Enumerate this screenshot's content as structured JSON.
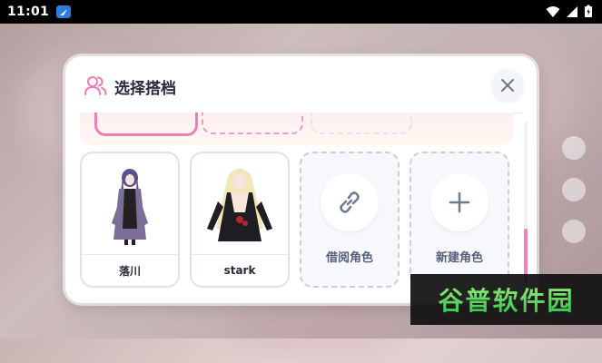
{
  "status_bar": {
    "time": "11:01"
  },
  "dialog": {
    "title": "选择搭档",
    "icons": {
      "header": "users-icon",
      "close": "close-icon"
    }
  },
  "characters": [
    {
      "name": "落川"
    },
    {
      "name": "stark"
    }
  ],
  "actions": [
    {
      "label": "借阅角色",
      "icon": "link-icon"
    },
    {
      "label": "新建角色",
      "icon": "plus-icon"
    }
  ],
  "watermark": {
    "text": "谷普软件园"
  },
  "colors": {
    "accent": "#f07fb5",
    "text": "#2b2b3a",
    "muted": "#56607a"
  }
}
